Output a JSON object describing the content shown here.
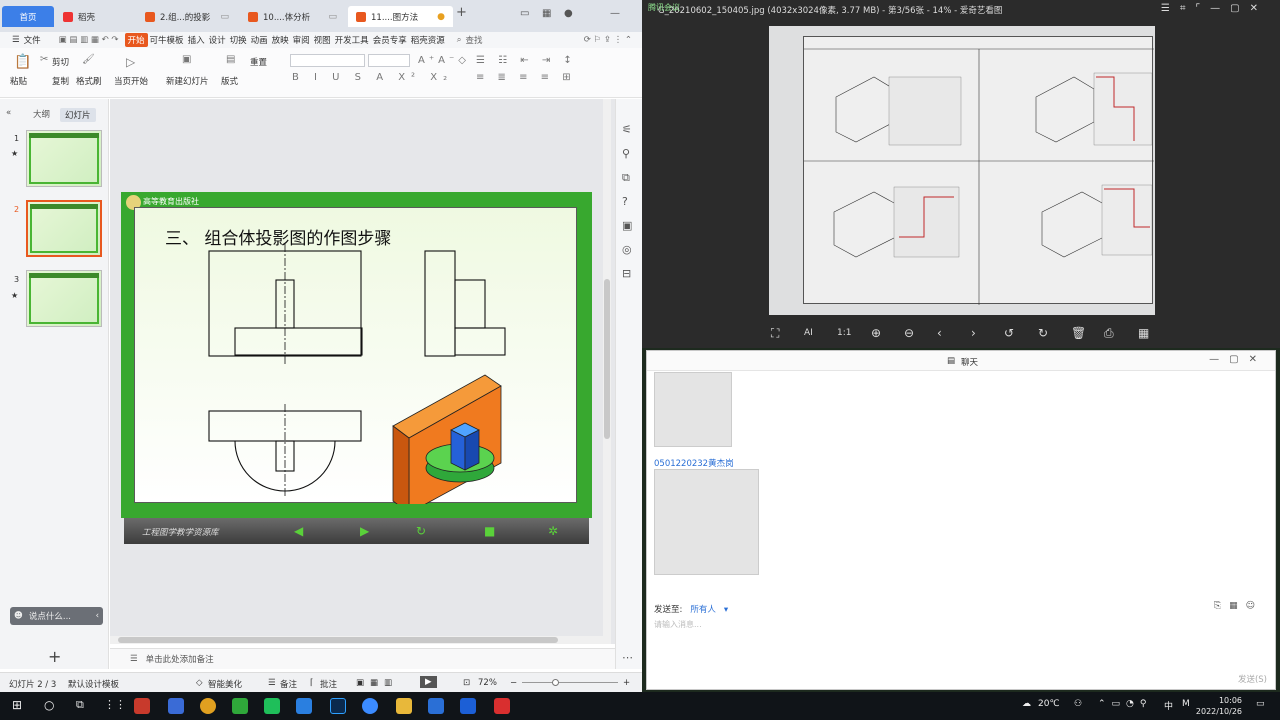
{
  "wps": {
    "tabs": [
      {
        "label": "首页"
      },
      {
        "label": "稻壳"
      },
      {
        "label": "2.组...的投影"
      },
      {
        "label": "10....体分析"
      },
      {
        "label": "11....图方法"
      }
    ],
    "menu": [
      "文件",
      "开始",
      "可牛模板",
      "插入",
      "设计",
      "切换",
      "动画",
      "放映",
      "审阅",
      "视图",
      "开发工具",
      "会员专享",
      "稻壳资源",
      "查找"
    ],
    "ribbon": {
      "paste": "粘贴",
      "cut": "剪切",
      "copy": "复制",
      "format_painter": "格式刷",
      "from_current": "当页开始",
      "new_slide": "新建幻灯片",
      "layout": "版式",
      "reset": "重置"
    },
    "pane_tabs": [
      "大纲",
      "幻灯片"
    ],
    "thumbs": [
      "1",
      "2",
      "3"
    ],
    "ask_placeholder": "说点什么...",
    "notes_placeholder": "单击此处添加备注",
    "slide": {
      "publisher": "高等教育出版社",
      "title": "三、  组合体投影图的作图步骤",
      "library": "工程图学教学资源库"
    },
    "status": {
      "slide_index": "幻灯片 2 / 3",
      "template": "默认设计模板",
      "beautify": "智能美化",
      "notes": "备注",
      "comments": "批注",
      "zoom": "72%"
    }
  },
  "viewer": {
    "meeting": "腾讯会议",
    "title": "G_20210602_150405.jpg (4032x3024像素, 3.77 MB) - 第3/56张 - 14% - 爱奇艺看图"
  },
  "chat": {
    "title": "聊天",
    "sender": "0501220232黄杰岗",
    "send_to_label": "发送至:",
    "send_to_value": "所有人",
    "input_placeholder": "请输入消息...",
    "send_button": "发送(S)"
  },
  "taskbar": {
    "weather": "20℃",
    "ime": "中",
    "time": "10:06",
    "date": "2022/10/26"
  }
}
